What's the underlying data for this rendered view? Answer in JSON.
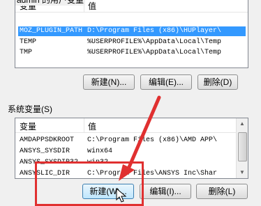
{
  "user_vars": {
    "caption": "admin 的用户变量",
    "header": {
      "name": "变量",
      "value": "值"
    },
    "rows": [
      {
        "name": "MOZ_PLUGIN_PATH",
        "value": "D:\\Program Files (x86)\\HUPlayer\\",
        "selected": true
      },
      {
        "name": "TEMP",
        "value": "%USERPROFILE%\\AppData\\Local\\Temp"
      },
      {
        "name": "TMP",
        "value": "%USERPROFILE%\\AppData\\Local\\Temp"
      }
    ],
    "buttons": {
      "new": "新建(N)...",
      "edit": "编辑(E)...",
      "delete": "删除(D)"
    }
  },
  "system_vars": {
    "caption": "系统变量(S)",
    "header": {
      "name": "变量",
      "value": "值"
    },
    "rows": [
      {
        "name": "AMDAPPSDKROOT",
        "value": "C:\\Program Files (x86)\\AMD APP\\"
      },
      {
        "name": "ANSYS_SYSDIR",
        "value": "winx64"
      },
      {
        "name": "ANSYS_SYSDIR32",
        "value": "win32"
      },
      {
        "name": "ANSYSLIC_DIR",
        "value": "C:\\Program Files\\ANSYS Inc\\Shar"
      }
    ],
    "buttons": {
      "new": "新建(W)...",
      "edit": "编辑(I)...",
      "delete": "删除(L)"
    }
  },
  "colors": {
    "highlight": "#e03030",
    "selection": "#3399ff"
  }
}
